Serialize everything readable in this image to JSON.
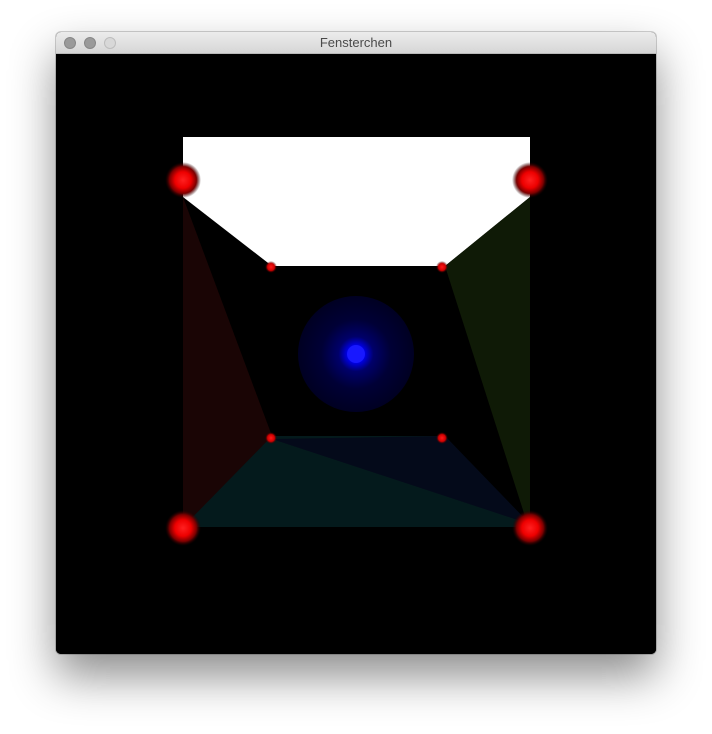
{
  "window": {
    "title": "Fensterchen",
    "controls": {
      "close": "close",
      "minimize": "minimize",
      "zoom": "zoom"
    }
  },
  "scene": {
    "background": "#000000",
    "ceiling_color": "#ffffff",
    "left_wall_color": "#1a0505",
    "right_wall_color": "#0f1a06",
    "floor_color": "#041a1c",
    "floor_far_color": "#040a1a",
    "light_color": "#0000ff",
    "corner_sphere_color": "#ff0000"
  }
}
